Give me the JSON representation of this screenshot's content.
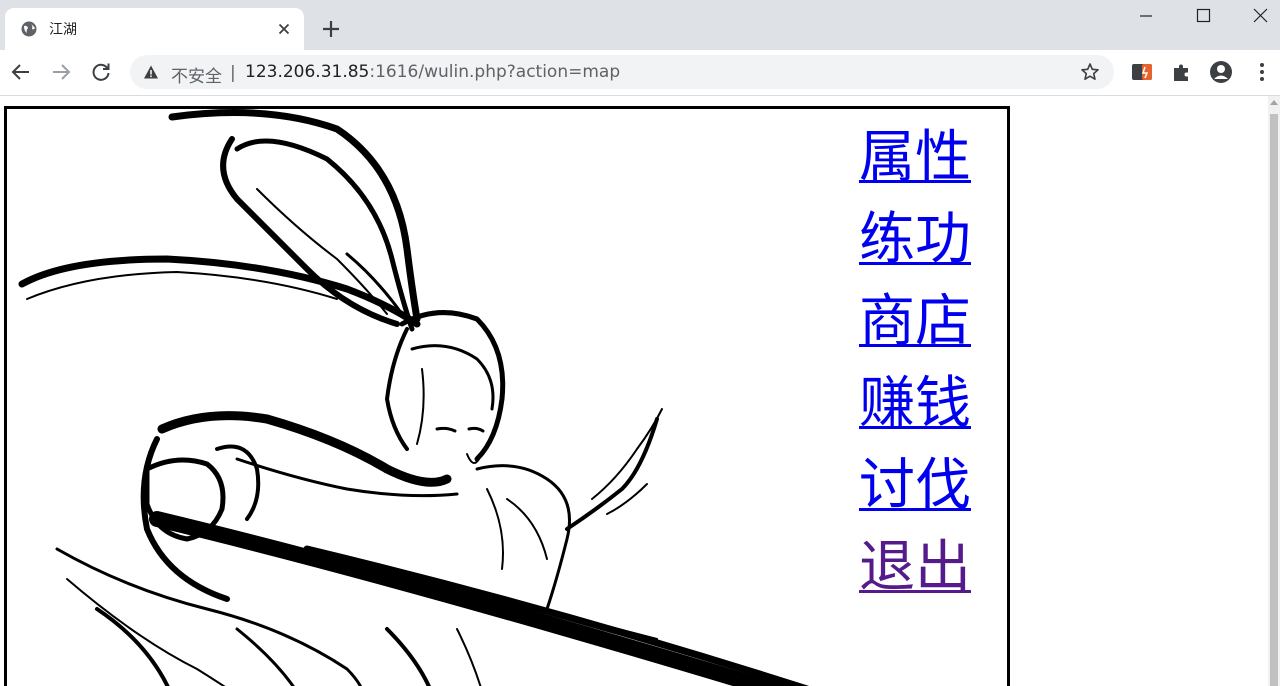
{
  "tab": {
    "title": "江湖"
  },
  "toolbar": {
    "security_label": "不安全",
    "separator": "|",
    "url_host": "123.206.31.85",
    "url_rest": ":1616/wulin.php?action=map"
  },
  "menu": {
    "items": [
      {
        "label": "属性",
        "visited": false
      },
      {
        "label": "练功",
        "visited": false
      },
      {
        "label": "商店",
        "visited": false
      },
      {
        "label": "赚钱",
        "visited": false
      },
      {
        "label": "讨伐",
        "visited": false
      },
      {
        "label": "退出",
        "visited": true
      }
    ]
  },
  "colors": {
    "link": "#0000ee",
    "visited_link": "#551a8b",
    "frame_border": "#000000"
  },
  "icons": [
    "globe-icon",
    "close-icon",
    "plus-icon",
    "minimize-icon",
    "maximize-icon",
    "window-close-icon",
    "back-arrow-icon",
    "forward-arrow-icon",
    "reload-icon",
    "warning-icon",
    "star-icon",
    "extension-icon",
    "puzzle-icon",
    "profile-icon",
    "kebab-menu-icon"
  ]
}
